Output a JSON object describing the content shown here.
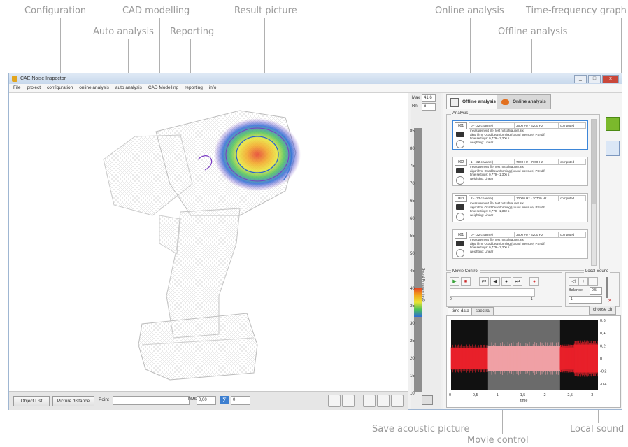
{
  "callouts": {
    "configuration": "Configuration",
    "cad_modelling": "CAD modelling",
    "result_picture": "Result picture",
    "auto_analysis": "Auto analysis",
    "reporting": "Reporting",
    "online_analysis": "Online analysis",
    "time_frequency_graph": "Time-frequency graph",
    "offline_analysis": "Offline analysis",
    "save_acoustic_picture": "Save acoustic picture",
    "movie_control": "Movie control",
    "local_sound": "Local sound"
  },
  "window": {
    "title": "CAE Noise Inspector",
    "controls": [
      "_",
      "□",
      "x"
    ]
  },
  "menu": [
    "File",
    "project",
    "configuration",
    "online analysis",
    "auto analysis",
    "CAD Modelling",
    "reporting",
    "info"
  ],
  "bottom_bar": {
    "object_list": "Object List",
    "picture_distance": "Picture distance",
    "point_label": "Point",
    "point_value": "",
    "rms_label": "RMS",
    "rms_value": "0,00",
    "sigma_icon": "sigma-icon",
    "sigma_value": "0",
    "icons": [
      "export-icon",
      "grid-icon",
      "home-icon",
      "view-icon",
      "axes-icon"
    ]
  },
  "scale": {
    "max_label": "Max",
    "max_value": "41,6",
    "rng_label": "Rn",
    "rng_value": "6",
    "ticks": [
      "85",
      "80",
      "75",
      "70",
      "65",
      "60",
      "55",
      "50",
      "45",
      "40",
      "35",
      "30",
      "25",
      "20",
      "15",
      "10"
    ],
    "vertical_label": "Sound Pressure in dB",
    "save_icon": "save-picture-icon"
  },
  "tabs": {
    "offline": "Offline analysis",
    "online": "Online analysis"
  },
  "analysis": {
    "group_label": "Analysis",
    "cards": [
      {
        "idx": "001",
        "name": "0 - (32 channel)",
        "band": "3600 Hz - 4200 Hz",
        "status": "computed",
        "lines": [
          "measurement file: test nutschrauber.atx",
          "algorithm:  Ocad beamforming (sound pressure) PSI-dif",
          "time settings:  0,779 - 1,306 s",
          "weighting:  Linear"
        ]
      },
      {
        "idx": "002",
        "name": "1 - (32 channel)",
        "band": "7000 Hz - 7700 Hz",
        "status": "computed",
        "lines": [
          "measurement file: test nutschrauber.atx",
          "algorithm:  Ocad beamforming (sound pressure) PSI-dif",
          "time settings:  0,779 - 1,306 s",
          "weighting:  Linear"
        ]
      },
      {
        "idx": "003",
        "name": "2 - (32 channel)",
        "band": "10000 Hz - 10700 Hz",
        "status": "computed",
        "lines": [
          "measurement file: test nutschrauber.atx",
          "algorithm:  Ocad beamforming (sound pressure) PSI-dif",
          "time settings:  0,779 - 1,332 s",
          "weighting:  Linear"
        ]
      },
      {
        "idx": "001",
        "name": "0 - (32 channel)",
        "band": "3600 Hz - 4200 Hz",
        "status": "computed",
        "lines": [
          "measurement file: test nutschrauber.atx",
          "algorithm:  Ocad beamforming (sound pressure) PSI-dif",
          "time settings:  0,779 - 1,306 s",
          "weighting:  Linear"
        ]
      }
    ]
  },
  "movie_control": {
    "label": "Movie Control",
    "buttons": [
      "play-icon",
      "stop-icon",
      "first-frame-icon",
      "prev-frame-icon",
      "next-frame-icon",
      "last-frame-icon",
      "record-icon"
    ],
    "slider_min": "0",
    "slider_max": "1"
  },
  "local_sound": {
    "label": "Local Sound",
    "balance_label": "Balance",
    "balance_value": "0,5",
    "slider_value": "1"
  },
  "plot_tabs": {
    "time_data": "time data",
    "spectra": "spectra",
    "choose_ch": "choose ch"
  },
  "chart_data": {
    "type": "area",
    "xlabel": "time",
    "ylabel": "",
    "x_ticks": [
      "0",
      "0,5",
      "1",
      "1,5",
      "2",
      "2,5",
      "3"
    ],
    "y_ticks": [
      "0,6",
      "0,4",
      "0,2",
      "0",
      "-0,2",
      "-0,4"
    ],
    "xlim": [
      0,
      3.1
    ],
    "ylim": [
      -0.5,
      0.6
    ],
    "series": [
      {
        "values": [
          {
            "t0": 0,
            "t1": 0.78,
            "amp": 0.17
          },
          {
            "t0": 0.78,
            "t1": 2.3,
            "amp": 0.2
          },
          {
            "t0": 2.3,
            "t1": 2.6,
            "amp": 0.17
          }
        ]
      },
      {
        "values": [
          {
            "t0": 2.6,
            "t1": 3.1,
            "amp": 0.22
          }
        ]
      }
    ],
    "highlight_range": [
      0.78,
      2.3
    ],
    "colors": {
      "signal": "#e8202a",
      "highlight": "#f0a0a5",
      "background": "#111111"
    }
  },
  "side_icons": [
    "time-frequency-graph-icon",
    "report-document-icon"
  ]
}
